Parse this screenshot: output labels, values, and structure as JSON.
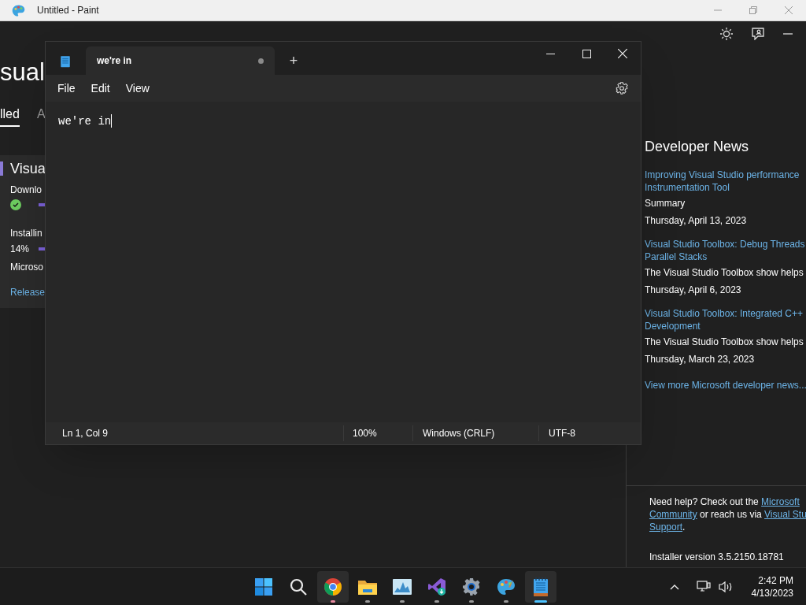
{
  "paint_window": {
    "title": "Untitled - Paint"
  },
  "installer": {
    "heading": "sual",
    "tabs": [
      {
        "label": "lled",
        "selected": true
      },
      {
        "label": "A",
        "selected": false
      }
    ],
    "product_card": {
      "name": "Visua",
      "download_label": "Downlo",
      "download_done": true,
      "download_progress": {
        "level": 1
      },
      "install_label": "Installin",
      "install_percent": "14%",
      "install_progress": {
        "level": 0.14
      },
      "publisher": "Microso",
      "release_link": "Release"
    },
    "news": {
      "heading": "Developer News",
      "items": [
        {
          "title_lines": [
            "Improving Visual Studio performance",
            "Instrumentation Tool"
          ],
          "summary": "Summary",
          "date": "Thursday, April 13, 2023"
        },
        {
          "title_lines": [
            "Visual Studio Toolbox: Debug Threads",
            "Parallel Stacks"
          ],
          "summary": "The Visual Studio Toolbox show helps",
          "date": "Thursday, April 6, 2023"
        },
        {
          "title_lines": [
            "Visual Studio Toolbox: Integrated C++",
            "Development"
          ],
          "summary": "The Visual Studio Toolbox show helps",
          "date": "Thursday, March 23, 2023"
        }
      ],
      "more_link": "View more Microsoft developer news..."
    },
    "help": {
      "lines": [
        [
          {
            "kind": "text",
            "text": "Need help? Check out the "
          },
          {
            "kind": "link",
            "text": "Microsoft"
          }
        ],
        [
          {
            "kind": "link",
            "text": "Community"
          },
          {
            "kind": "text",
            "text": " or reach us via "
          },
          {
            "kind": "link",
            "text": "Visual Stu"
          }
        ],
        [
          {
            "kind": "link",
            "text": "Support"
          },
          {
            "kind": "text",
            "text": "."
          }
        ]
      ],
      "version": "Installer version 3.5.2150.18781"
    }
  },
  "notepad": {
    "tab": {
      "title": "we're in",
      "unsaved": true,
      "selected": true
    },
    "new_tab": "+",
    "menu": [
      "File",
      "Edit",
      "View"
    ],
    "text": "we're in",
    "status_bar": [
      "Ln 1, Col 9",
      "100%",
      "Windows (CRLF)",
      "UTF-8"
    ]
  },
  "taskbar": {
    "items": [
      {
        "kind": "start",
        "selected": false
      },
      {
        "kind": "search",
        "selected": false
      },
      {
        "kind": "chrome",
        "selected": true,
        "color": "#e98aa0"
      },
      {
        "kind": "folder",
        "selected": false,
        "color": "#9a9a9a"
      },
      {
        "kind": "monitor",
        "selected": false,
        "color": "#9a9a9a"
      },
      {
        "kind": "studio",
        "selected": false,
        "color": "#9a9a9a"
      },
      {
        "kind": "settings",
        "selected": false,
        "color": "#9a9a9a"
      },
      {
        "kind": "paint",
        "selected": false,
        "color": "#9a9a9a"
      },
      {
        "kind": "notepad",
        "selected": true,
        "color": "#4cc2ff"
      }
    ],
    "time": "2:42 PM",
    "date": "4/13/2023"
  }
}
